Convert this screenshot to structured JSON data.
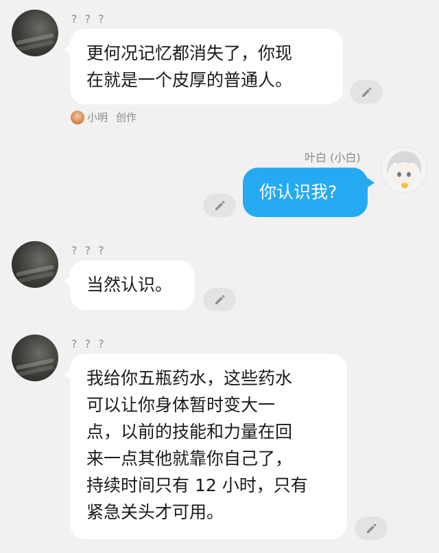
{
  "messages": [
    {
      "sender": "? ? ?",
      "lines": [
        "更何况记忆都消失了，你现",
        "在就是一个皮厚的普通人。"
      ],
      "credit": {
        "author": "小明",
        "tag": "创作"
      }
    },
    {
      "sender": "叶白 (小白)",
      "lines": [
        "你认识我?"
      ]
    },
    {
      "sender": "? ? ?",
      "lines": [
        "当然认识。"
      ]
    },
    {
      "sender": "? ? ?",
      "lines": [
        "我给你五瓶药水，这些药水",
        "可以让你身体暂时变大一",
        "点，以前的技能和力量在回",
        "来一点其他就靠你自己了，",
        "持续时间只有 12 小时，只有",
        "紧急关头才可用。"
      ]
    }
  ],
  "colors": {
    "background": "#f1f1f1",
    "bubble_other": "#ffffff",
    "bubble_self": "#25aaf1",
    "edit_button": "#e3e3e3"
  },
  "icons": {
    "edit": "pencil-icon"
  }
}
